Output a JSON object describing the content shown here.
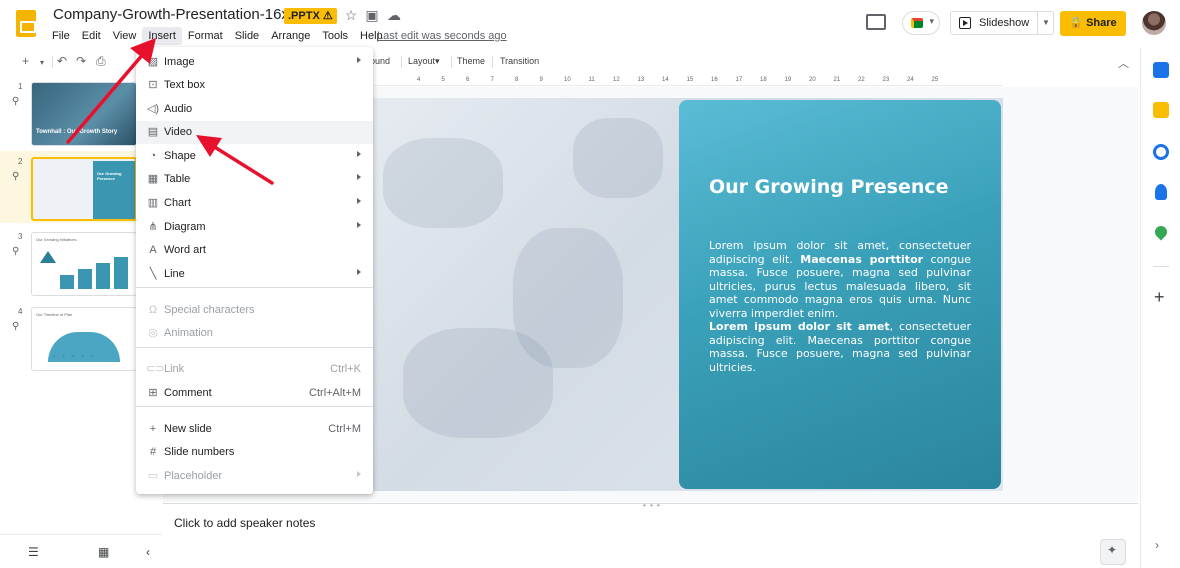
{
  "doc": {
    "title": "Company-Growth-Presentation-16x9",
    "badge": ".PPTX ⚠",
    "last_edit": "Last edit was seconds ago"
  },
  "menubar": [
    "File",
    "Edit",
    "View",
    "Insert",
    "Format",
    "Slide",
    "Arrange",
    "Tools",
    "Help"
  ],
  "header": {
    "slideshow_label": "Slideshow",
    "share_label": "Share"
  },
  "toolbar": {
    "bound_fragment": "ound",
    "layout": "Layout",
    "theme": "Theme",
    "transition": "Transition"
  },
  "ruler_ticks": [
    "4",
    "5",
    "6",
    "7",
    "8",
    "9",
    "10",
    "11",
    "12",
    "13",
    "14",
    "15",
    "16",
    "17",
    "18",
    "19",
    "20",
    "21",
    "22",
    "23",
    "24",
    "25"
  ],
  "filmstrip": {
    "slides": [
      {
        "num": "1",
        "caption": "Townhall : Our Growth Story"
      },
      {
        "num": "2",
        "caption": "Our Growing Presence"
      },
      {
        "num": "3",
        "caption": "Our Growing Initiatives"
      },
      {
        "num": "4",
        "caption": "Our Timeline of Plan"
      }
    ]
  },
  "slide": {
    "heading": "Our Growing Presence",
    "body_p1_a": "Lorem ipsum dolor sit amet, consectetuer adipiscing elit. ",
    "body_p1_b": "Maecenas porttitor",
    "body_p1_c": " congue massa. Fusce posuere, magna sed pulvinar ultricies, purus lectus malesuada libero, sit amet commodo magna eros quis urna. Nunc viverra imperdiet enim.",
    "body_p2_a": "Lorem ipsum dolor sit amet",
    "body_p2_b": ", consectetuer adipiscing elit. Maecenas porttitor congue massa. Fusce posuere, magna sed pulvinar ultricies."
  },
  "notes": {
    "placeholder": "Click to add speaker notes"
  },
  "insert_menu": {
    "items": [
      {
        "label": "Image",
        "icon": "image-icon",
        "submenu": true
      },
      {
        "label": "Text box",
        "icon": "text-box-icon"
      },
      {
        "label": "Audio",
        "icon": "audio-icon"
      },
      {
        "label": "Video",
        "icon": "video-icon",
        "hover": true
      },
      {
        "label": "Shape",
        "icon": "shape-icon",
        "submenu": true
      },
      {
        "label": "Table",
        "icon": "table-icon",
        "submenu": true
      },
      {
        "label": "Chart",
        "icon": "chart-icon",
        "submenu": true
      },
      {
        "label": "Diagram",
        "icon": "diagram-icon",
        "submenu": true
      },
      {
        "label": "Word art",
        "icon": "word-art-icon"
      },
      {
        "label": "Line",
        "icon": "line-icon",
        "submenu": true
      },
      {
        "label": "Special characters",
        "icon": "omega-icon",
        "disabled": true
      },
      {
        "label": "Animation",
        "icon": "animation-icon",
        "disabled": true
      },
      {
        "label": "Link",
        "icon": "link-icon",
        "shortcut": "Ctrl+K",
        "disabled": true
      },
      {
        "label": "Comment",
        "icon": "comment-icon",
        "shortcut": "Ctrl+Alt+M"
      },
      {
        "label": "New slide",
        "icon": "plus-icon",
        "shortcut": "Ctrl+M"
      },
      {
        "label": "Slide numbers",
        "icon": "hash-icon"
      },
      {
        "label": "Placeholder",
        "icon": "placeholder-icon",
        "submenu": true,
        "disabled": true
      }
    ]
  },
  "colors": {
    "accent": "#fbbc04",
    "slide_card": "#3aa0b9",
    "annotation_arrow": "#e8112d"
  }
}
